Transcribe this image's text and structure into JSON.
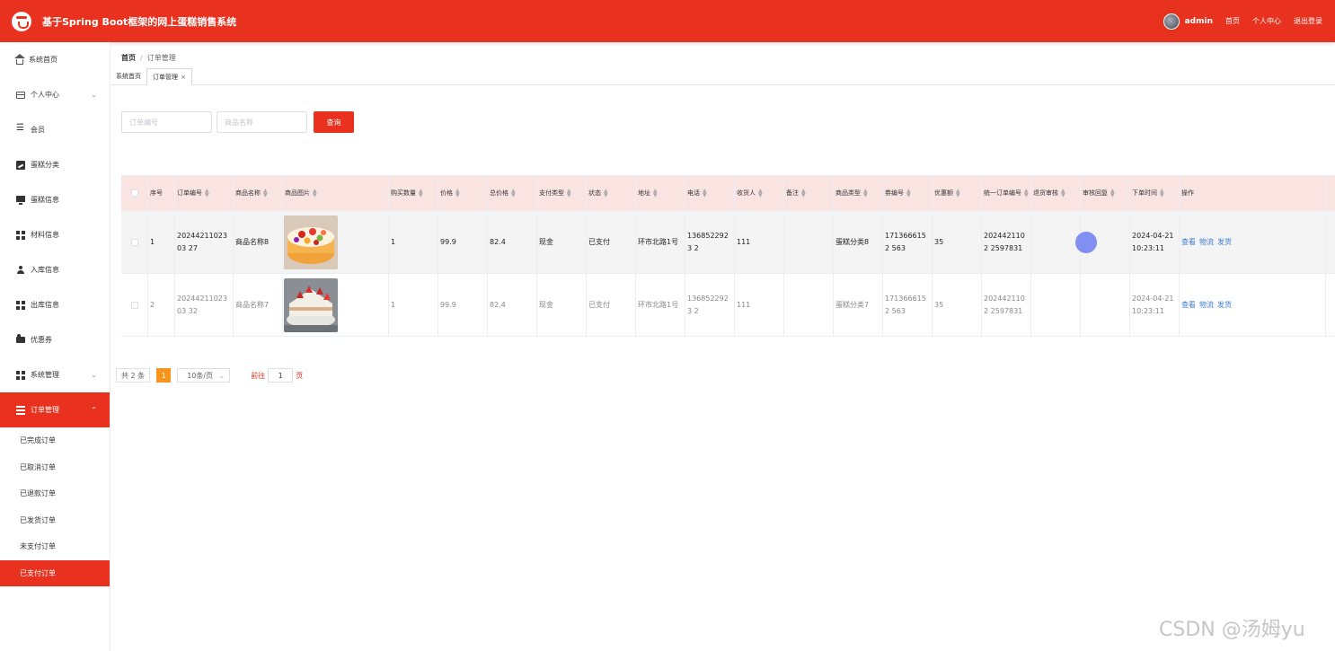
{
  "header": {
    "title": "基于Spring Boot框架的网上蛋糕销售系统",
    "username": "admin",
    "links": [
      "首页",
      "个人中心",
      "退出登录"
    ]
  },
  "sidebar": {
    "items": [
      {
        "label": "系统首页",
        "icon": "home-icon"
      },
      {
        "label": "个人中心",
        "icon": "card-icon",
        "expandable": true
      },
      {
        "label": "会员",
        "icon": "list-icon"
      },
      {
        "label": "蛋糕分类",
        "icon": "chart-icon"
      },
      {
        "label": "蛋糕信息",
        "icon": "monitor-icon"
      },
      {
        "label": "材料信息",
        "icon": "grid-icon"
      },
      {
        "label": "入库信息",
        "icon": "user-icon"
      },
      {
        "label": "出库信息",
        "icon": "grid-icon"
      },
      {
        "label": "优惠券",
        "icon": "coupon-icon"
      },
      {
        "label": "系统管理",
        "icon": "grid-icon",
        "expandable": true
      },
      {
        "label": "订单管理",
        "icon": "table-icon",
        "expandable": true,
        "active": true
      }
    ],
    "subitems": [
      "已完成订单",
      "已取消订单",
      "已退款订单",
      "已发货订单",
      "未支付订单",
      "已支付订单"
    ]
  },
  "breadcrumb": {
    "home": "首页",
    "current": "订单管理"
  },
  "tabs": [
    {
      "label": "系统首页",
      "active": false
    },
    {
      "label": "订单管理",
      "active": true,
      "close": "×"
    }
  ],
  "search": {
    "order_no_placeholder": "订单编号",
    "product_name_placeholder": "商品名称",
    "query_label": "查询"
  },
  "table": {
    "columns": [
      "序号",
      "订单编号",
      "商品名称",
      "商品图片",
      "购买数量",
      "价格",
      "总价格",
      "支付类型",
      "状态",
      "地址",
      "电话",
      "收货人",
      "备注",
      "商品类型",
      "券编号",
      "优惠额",
      "统一订单编号",
      "退货审核",
      "审核回复",
      "下单时间",
      "操作"
    ],
    "rows": [
      {
        "index": "1",
        "order_no": "2024421102303 27",
        "product_name": "商品名称8",
        "image": "cake-fruit",
        "qty": "1",
        "price": "99.9",
        "total": "82.4",
        "pay_type": "现金",
        "status": "已支付",
        "address": "环市北路1号",
        "phone": "1368522923 2",
        "receiver": "111",
        "remark": "",
        "category": "蛋糕分类8",
        "coupon_no": "1713666152 563",
        "discount": "35",
        "unified_no": "2024421102 2597831",
        "return_review": "",
        "review_reply": "",
        "order_time": "2024-04-21 10:23:11",
        "ops": [
          "查看",
          "物流",
          "发货"
        ]
      },
      {
        "index": "2",
        "order_no": "2024421102303 32",
        "product_name": "商品名称7",
        "image": "cake-strawberry",
        "qty": "1",
        "price": "99.9",
        "total": "82.4",
        "pay_type": "现金",
        "status": "已支付",
        "address": "环市北路1号",
        "phone": "1368522923 2",
        "receiver": "111",
        "remark": "",
        "category": "蛋糕分类7",
        "coupon_no": "1713666152 563",
        "discount": "35",
        "unified_no": "2024421102 2597831",
        "return_review": "",
        "review_reply": "",
        "order_time": "2024-04-21 10:23:11",
        "ops": [
          "查看",
          "物流",
          "发货"
        ]
      }
    ]
  },
  "pagination": {
    "total": "共 2 条",
    "current": "1",
    "page_size": "10条/页",
    "goto_prefix": "前往",
    "goto_value": "1",
    "goto_suffix": "页"
  },
  "watermark": "CSDN @汤姆yu",
  "colors": {
    "primary": "#e8321f",
    "header_bg": "#fae4e2",
    "page_active": "#f7941d",
    "link": "#3a7bd5"
  }
}
